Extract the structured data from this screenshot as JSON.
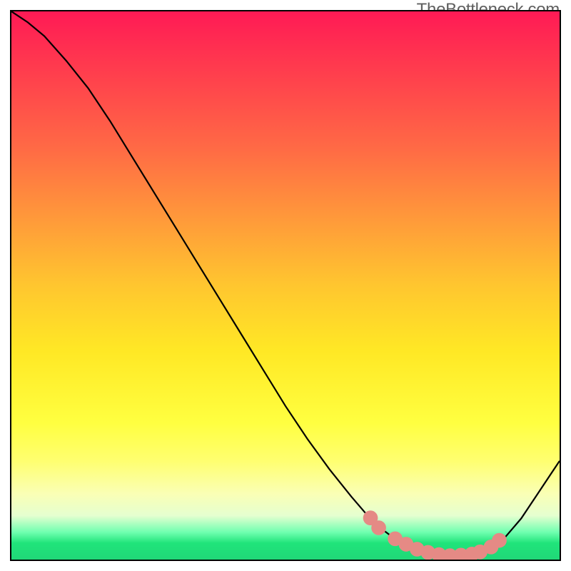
{
  "watermark_text": "TheBottleneck.com",
  "colors": {
    "curve": "#000000",
    "marker": "#e58a85",
    "border": "#000000"
  },
  "chart_data": {
    "type": "line",
    "title": "",
    "xlabel": "",
    "ylabel": "",
    "xlim": [
      0,
      100
    ],
    "ylim": [
      0,
      100
    ],
    "grid": false,
    "legend": false,
    "series": [
      {
        "name": "bottleneck-curve",
        "x": [
          0,
          3,
          6,
          10,
          14,
          18,
          22,
          26,
          30,
          34,
          38,
          42,
          46,
          50,
          54,
          58,
          62,
          65,
          67,
          69,
          71,
          73,
          75,
          77,
          79,
          81,
          83,
          85,
          87,
          90,
          93,
          96,
          100
        ],
        "y": [
          100,
          98,
          95.5,
          91,
          86,
          80,
          73.5,
          67,
          60.5,
          54,
          47.5,
          41,
          34.5,
          28,
          22,
          16.5,
          11.5,
          8,
          6,
          4.5,
          3.2,
          2.3,
          1.6,
          1.1,
          0.8,
          0.7,
          0.8,
          1.2,
          2.0,
          4.0,
          7.5,
          12,
          18
        ]
      }
    ],
    "markers": {
      "name": "highlight-points",
      "x": [
        65.5,
        67,
        70,
        72,
        74,
        76,
        78,
        80,
        82,
        84,
        85.5,
        87.5,
        89
      ],
      "y": [
        7.6,
        5.8,
        3.8,
        2.8,
        1.9,
        1.3,
        0.9,
        0.7,
        0.8,
        1.0,
        1.4,
        2.3,
        3.5
      ],
      "radius": 6.5
    }
  }
}
